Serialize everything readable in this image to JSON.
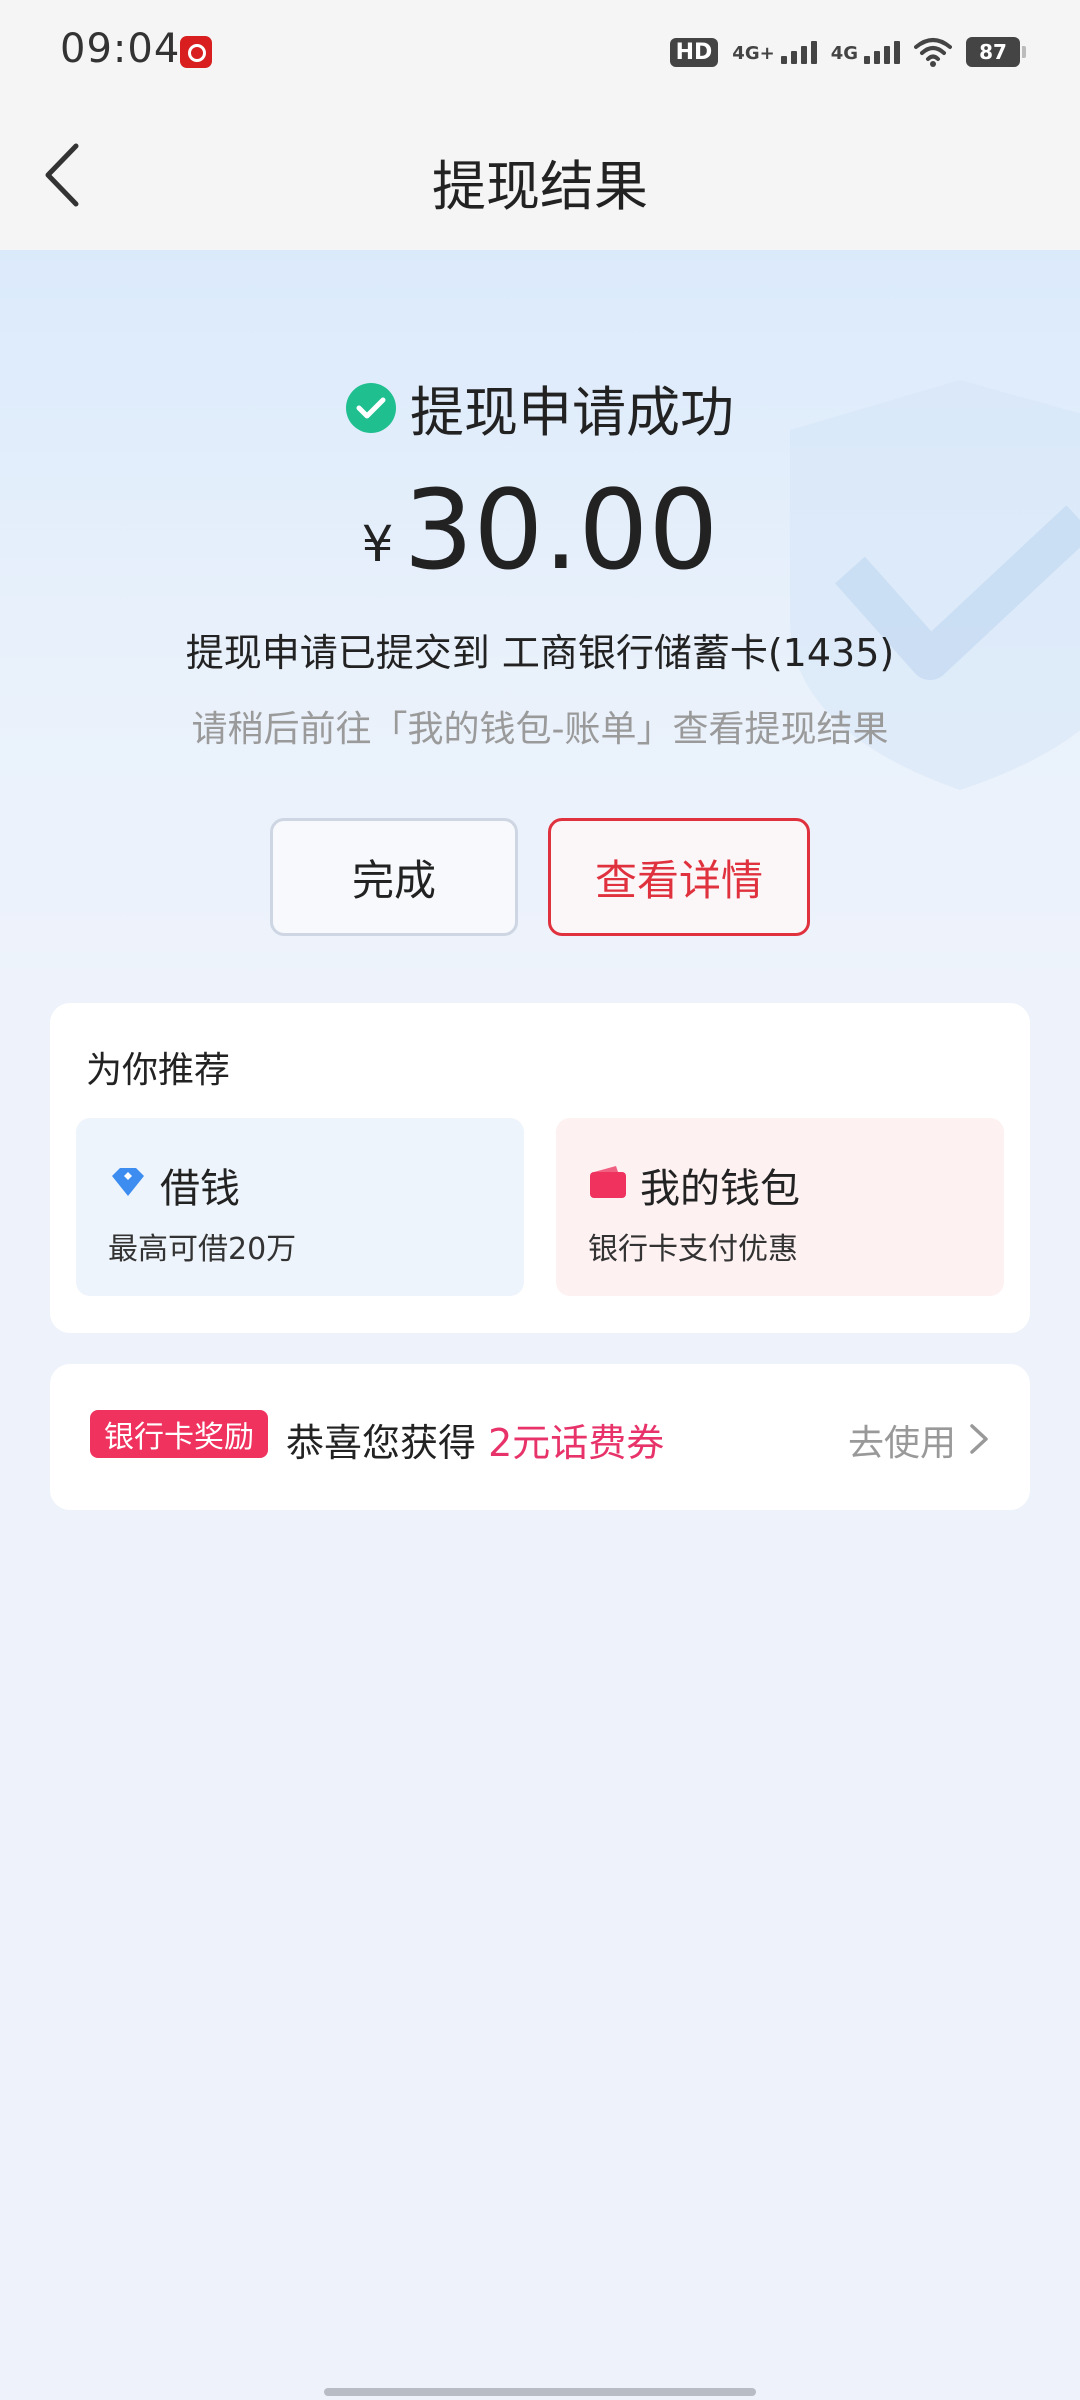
{
  "status_bar": {
    "time": "09:04",
    "hd_label": "HD",
    "net1_label": "4G+",
    "net2_label": "4G",
    "battery": "87",
    "app_icon": "netease-music-icon"
  },
  "header": {
    "title": "提现结果",
    "back_icon": "chevron-left-icon"
  },
  "result": {
    "status_text": "提现申请成功",
    "status_icon": "check-circle-icon",
    "status_color": "#1fbf8f",
    "currency_symbol": "¥",
    "amount": "30.00",
    "submitted_to": "提现申请已提交到 工商银行储蓄卡(1435)",
    "hint": "请稍后前往「我的钱包-账单」查看提现结果"
  },
  "actions": {
    "done_label": "完成",
    "detail_label": "查看详情",
    "accent_color": "#e0323e"
  },
  "recommend": {
    "title": "为你推荐",
    "items": [
      {
        "label": "借钱",
        "sub": "最高可借20万",
        "icon": "diamond-icon"
      },
      {
        "label": "我的钱包",
        "sub": "银行卡支付优惠",
        "icon": "wallet-icon"
      }
    ]
  },
  "reward": {
    "badge": "银行卡奖励",
    "text_prefix": "恭喜您获得",
    "text_highlight": "2元话费券",
    "link_label": "去使用",
    "highlight_color": "#e8336a"
  }
}
